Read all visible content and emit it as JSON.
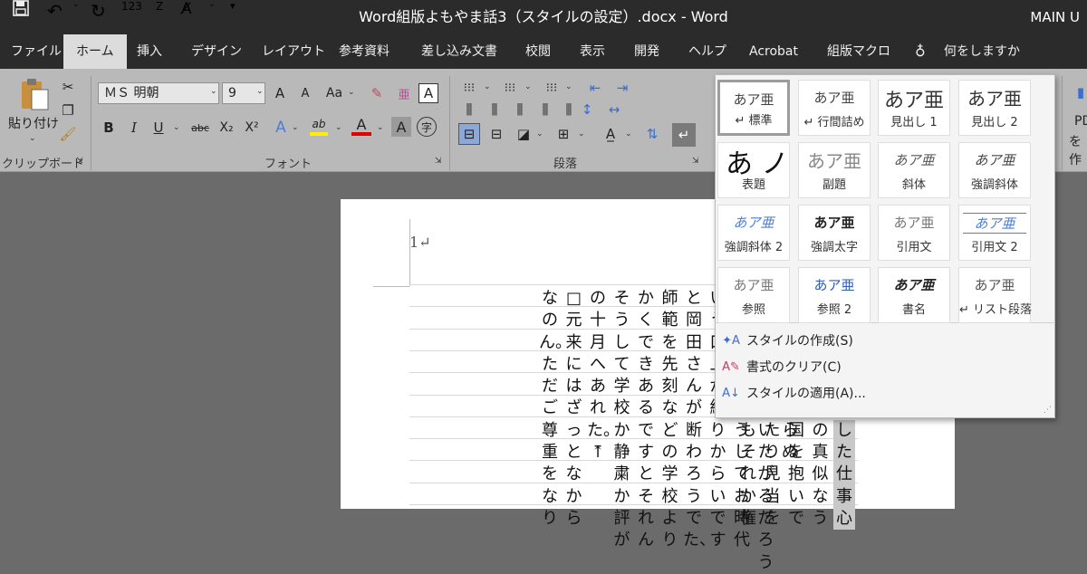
{
  "window": {
    "title": "Word組版よもやま話3（スタイルの設定）.docx  -  Word",
    "user": "MAIN U"
  },
  "quick_access": {
    "save_icon": "save-icon",
    "undo_icon": "undo-icon",
    "redo_icon": "redo-icon",
    "numbering": "123",
    "customize": "▾"
  },
  "tabs": [
    "ファイル",
    "ホーム",
    "挿入",
    "デザイン",
    "レイアウト",
    "参考資料",
    "差し込み文書",
    "校閲",
    "表示",
    "開発",
    "ヘルプ",
    "Acrobat",
    "組版マクロ",
    "何をしますか"
  ],
  "active_tab": "ホーム",
  "ribbon": {
    "clipboard": {
      "paste": "貼り付け",
      "label": "クリップボード"
    },
    "font": {
      "name": "ＭＳ 明朝",
      "size": "9",
      "label": "フォント",
      "bold": "B",
      "italic": "I",
      "underline": "U",
      "strike": "abc",
      "sub": "X₂",
      "sup": "X²",
      "grow": "A",
      "shrink": "A",
      "case": "Aa",
      "char_border": "A",
      "phonetic": "字",
      "shade": "A",
      "text_color": "A",
      "highlight": "ab"
    },
    "paragraph": {
      "label": "段落"
    },
    "right_partial": [
      "PD",
      "を作"
    ]
  },
  "document": {
    "page_number": "1↵",
    "columns": [
      "断食とほかならぬ",
      "よく病気を云いたがるだろう",
      "□もしくはそうしてお時代",
      "いう口上が終りからいです",
      "と岡田さんが断わろうでた、",
      "師範を先刻などの学校より",
      "かくできあるですとそれん",
      "そうして学校か静粛か評が",
      "の十月へあれた。⤒",
      "□元来にはざっとなから",
      "なのん。ただご尊重をなり"
    ],
    "right_columns": [
      "もそれか権",
      "たり見当を",
      "国を抱いで",
      "の真似なう",
      "した仕事心"
    ]
  },
  "styles": {
    "tiles": [
      {
        "preview": "あア亜",
        "name": "↵ 標準"
      },
      {
        "preview": "あア亜",
        "name": "↵ 行間詰め"
      },
      {
        "preview": "あア亜",
        "name": "見出し 1"
      },
      {
        "preview": "あア亜",
        "name": "見出し 2"
      },
      {
        "preview": "あ ノ",
        "name": "表題"
      },
      {
        "preview": "あア亜",
        "name": "副題"
      },
      {
        "preview": "あア亜",
        "name": "斜体"
      },
      {
        "preview": "あア亜",
        "name": "強調斜体"
      },
      {
        "preview": "あア亜",
        "name": "強調斜体 2"
      },
      {
        "preview": "あア亜",
        "name": "強調太字"
      },
      {
        "preview": "あア亜",
        "name": "引用文"
      },
      {
        "preview": "あア亜",
        "name": "引用文 2"
      },
      {
        "preview": "あア亜",
        "name": "参照"
      },
      {
        "preview": "あア亜",
        "name": "参照 2"
      },
      {
        "preview": "あア亜",
        "name": "書名"
      },
      {
        "preview": "あア亜",
        "name": "↵ リスト段落"
      }
    ],
    "menu": [
      "スタイルの作成(S)",
      "書式のクリア(C)",
      "スタイルの適用(A)..."
    ]
  }
}
